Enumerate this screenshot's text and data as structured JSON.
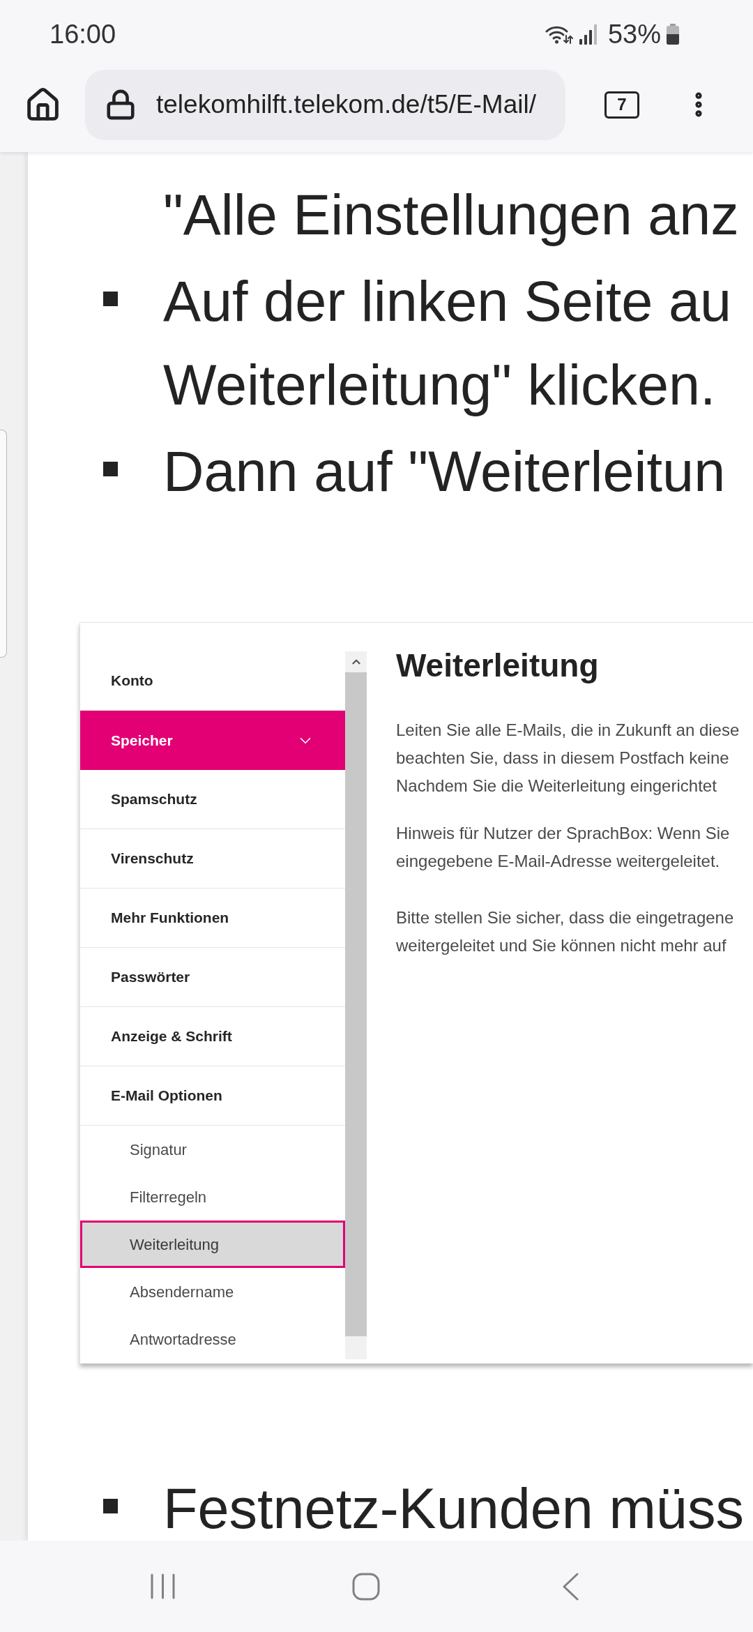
{
  "status_bar": {
    "time": "16:00",
    "battery": "53%"
  },
  "browser": {
    "url": "telekomhilft.telekom.de/t5/E-Mail/",
    "tab_count": "7"
  },
  "article_top": [
    {
      "kind": "continuation",
      "lines": [
        "\"Alle Einstellungen anz"
      ]
    },
    {
      "kind": "bullet",
      "lines": [
        "Auf der linken Seite au",
        "Weiterleitung\" klicken."
      ]
    },
    {
      "kind": "bullet",
      "lines": [
        "Dann auf \"Weiterleitun"
      ]
    }
  ],
  "screenshot": {
    "menu": [
      {
        "label": "Konto",
        "selected": false
      },
      {
        "label": "Speicher",
        "selected": true
      },
      {
        "label": "Spamschutz",
        "selected": false
      },
      {
        "label": "Virenschutz",
        "selected": false
      },
      {
        "label": "Mehr Funktionen",
        "selected": false
      },
      {
        "label": "Passwörter",
        "selected": false
      },
      {
        "label": "Anzeige & Schrift",
        "selected": false
      },
      {
        "label": "E-Mail Optionen",
        "selected": false,
        "children": [
          {
            "label": "Signatur",
            "selected": false
          },
          {
            "label": "Filterregeln",
            "selected": false
          },
          {
            "label": "Weiterleitung",
            "selected": true
          },
          {
            "label": "Absendername",
            "selected": false
          },
          {
            "label": "Antwortadresse",
            "selected": false
          }
        ]
      }
    ],
    "title": "Weiterleitung",
    "paragraphs": [
      {
        "lines": [
          "Leiten Sie alle E-Mails, die in Zukunft an diese",
          "beachten Sie, dass in diesem Postfach keine",
          "Nachdem Sie die Weiterleitung eingerichtet"
        ]
      },
      {
        "lines": [
          "Hinweis für Nutzer der SprachBox: Wenn Sie",
          "eingegebene E-Mail-Adresse weitergeleitet."
        ]
      },
      {
        "lines": [
          "Bitte stellen Sie sicher, dass die eingetragene",
          "weitergeleitet und Sie können nicht mehr auf"
        ]
      }
    ]
  },
  "article_bottom": [
    {
      "kind": "bullet",
      "lines": [
        "Festnetz-Kunden müss"
      ]
    }
  ]
}
